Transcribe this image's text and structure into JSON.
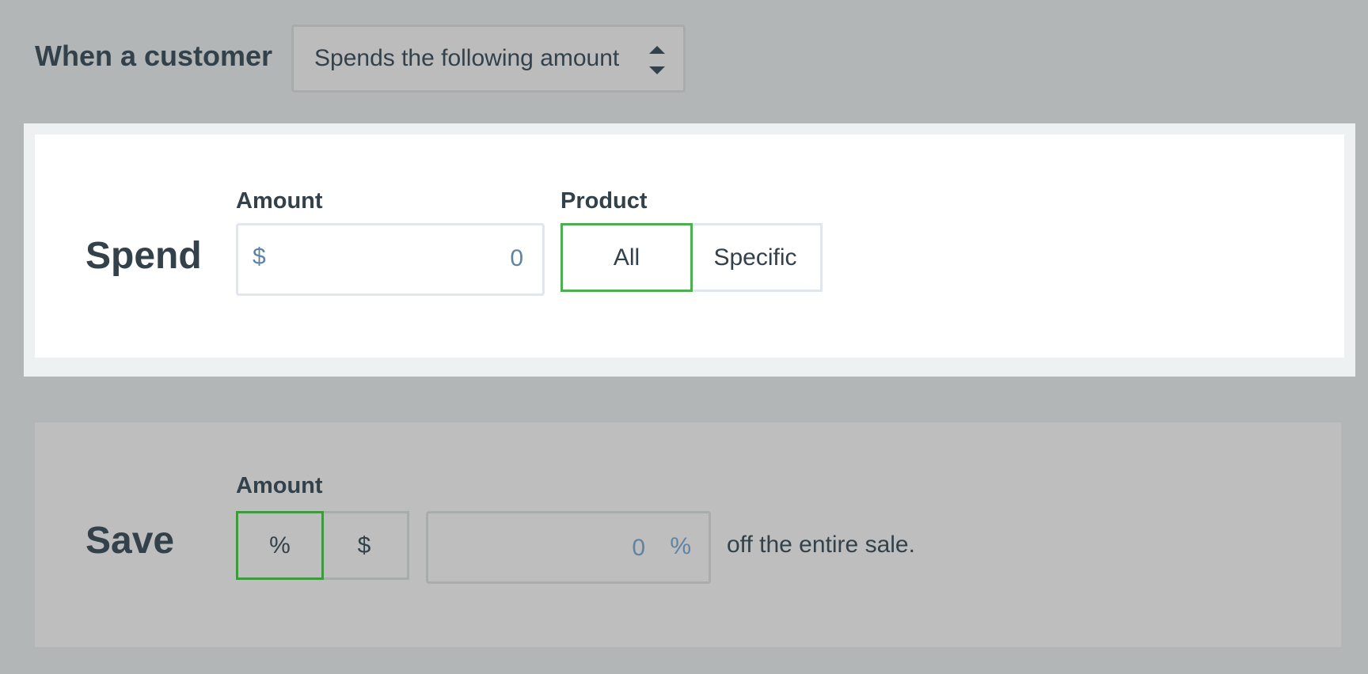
{
  "trigger": {
    "label": "When a customer",
    "selected_option": "Spends the following amount",
    "icon": "sort-arrows-icon"
  },
  "spend": {
    "title": "Spend",
    "amount_label": "Amount",
    "currency_prefix": "$",
    "amount_value": "0",
    "product_label": "Product",
    "product_options": [
      "All",
      "Specific"
    ],
    "product_selected": "All"
  },
  "save": {
    "title": "Save",
    "amount_label": "Amount",
    "type_options": [
      "%",
      "$"
    ],
    "type_selected": "%",
    "amount_value": "0",
    "amount_suffix": "%",
    "trailing_text": "off the entire sale."
  },
  "colors": {
    "page_background": "#b3b6b7",
    "text": "#33414b",
    "input_text": "#5f84a3",
    "active_border": "#4caf50",
    "input_border": "#e0e6eb"
  }
}
